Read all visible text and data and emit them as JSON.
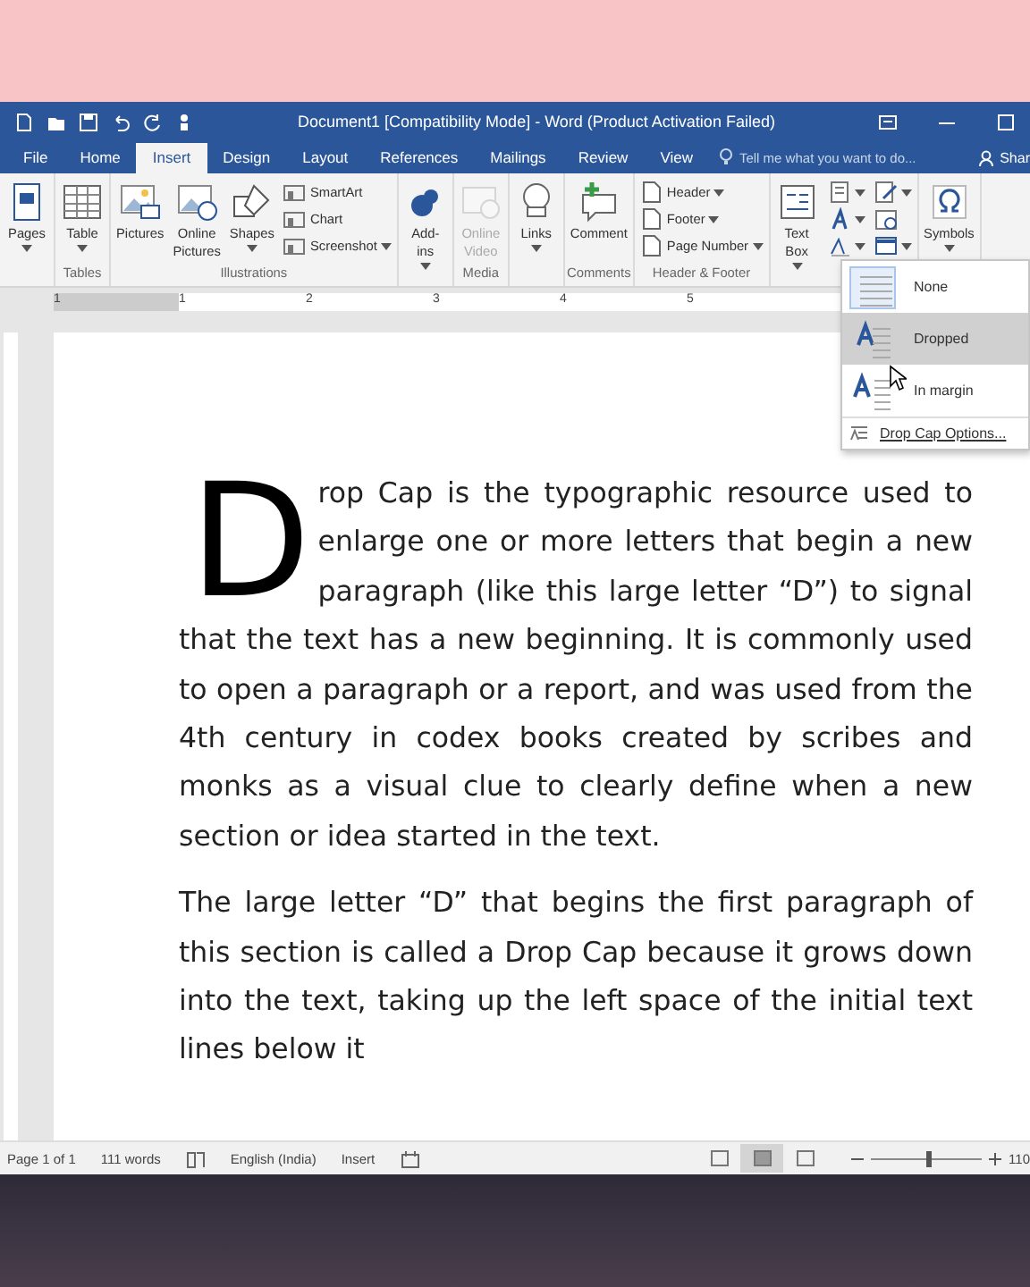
{
  "window": {
    "title": "Document1 [Compatibility Mode] - Word (Product Activation Failed)"
  },
  "tabs": [
    {
      "label": "File",
      "selected": false
    },
    {
      "label": "Home",
      "selected": false
    },
    {
      "label": "Insert",
      "selected": true
    },
    {
      "label": "Design",
      "selected": false
    },
    {
      "label": "Layout",
      "selected": false
    },
    {
      "label": "References",
      "selected": false
    },
    {
      "label": "Mailings",
      "selected": false
    },
    {
      "label": "Review",
      "selected": false
    },
    {
      "label": "View",
      "selected": false
    }
  ],
  "tell_me": {
    "placeholder": "Tell me what you want to do..."
  },
  "share": "Shar",
  "ribbon": {
    "groups": [
      {
        "buttons": [
          {
            "kind": "large",
            "label": "Pages",
            "has_menu": true,
            "disabled": false
          }
        ]
      },
      {
        "label": "Tables",
        "buttons": [
          {
            "kind": "large",
            "label": "Table",
            "has_menu": true,
            "disabled": false
          }
        ]
      },
      {
        "label": "Illustrations",
        "buttons": [
          {
            "kind": "large",
            "label": "Pictures",
            "has_menu": false,
            "disabled": false
          },
          {
            "kind": "large",
            "label": "Online\nPictures",
            "has_menu": false,
            "disabled": false
          },
          {
            "kind": "large",
            "label": "Shapes",
            "has_menu": true,
            "disabled": false
          },
          {
            "kind": "small",
            "label": "SmartArt",
            "has_menu": false,
            "disabled": false
          },
          {
            "kind": "small",
            "label": "Chart",
            "has_menu": false,
            "disabled": false
          },
          {
            "kind": "small",
            "label": "Screenshot",
            "has_menu": true,
            "disabled": false
          }
        ]
      },
      {
        "buttons": [
          {
            "kind": "large",
            "label": "Add-\nins",
            "has_menu": true,
            "disabled": false
          }
        ]
      },
      {
        "label": "Media",
        "buttons": [
          {
            "kind": "large",
            "label": "Online\nVideo",
            "has_menu": false,
            "disabled": true
          }
        ]
      },
      {
        "buttons": [
          {
            "kind": "large",
            "label": "Links",
            "has_menu": true,
            "disabled": false
          }
        ]
      },
      {
        "label": "Comments",
        "buttons": [
          {
            "kind": "large",
            "label": "Comment",
            "has_menu": false,
            "disabled": false
          }
        ]
      },
      {
        "label": "Header & Footer",
        "buttons": [
          {
            "kind": "small",
            "label": "Header",
            "has_menu": true,
            "disabled": false
          },
          {
            "kind": "small",
            "label": "Footer",
            "has_menu": true,
            "disabled": false
          },
          {
            "kind": "small",
            "label": "Page Number",
            "has_menu": true,
            "disabled": false
          }
        ]
      },
      {
        "buttons": [
          {
            "kind": "large",
            "label": "Text\nBox",
            "has_menu": true,
            "disabled": false
          },
          {
            "kind": "icon",
            "has_menu": true,
            "disabled": false
          },
          {
            "kind": "icon",
            "has_menu": true,
            "disabled": false
          },
          {
            "kind": "icon",
            "has_menu": true,
            "disabled": false
          },
          {
            "kind": "icon",
            "has_menu": true,
            "disabled": false
          },
          {
            "kind": "icon",
            "has_menu": false,
            "disabled": false
          },
          {
            "kind": "icon",
            "has_menu": true,
            "disabled": false
          }
        ]
      },
      {
        "buttons": [
          {
            "kind": "large",
            "label": "Symbols",
            "has_menu": true,
            "disabled": false
          }
        ]
      }
    ]
  },
  "ruler": {
    "labels": [
      "1",
      "1",
      "2",
      "3",
      "4",
      "5"
    ]
  },
  "document": {
    "paragraphs": [
      {
        "text": "Drop Cap is the typographic resource used to enlarge one or more letters that begin a new paragraph (like this large letter “D”) to signal that the text has a new beginning. It is commonly used to open a paragraph or a report, and was used from the 4th century in codex books created by scribes and monks as a visual clue to clearly define when a new section or idea started in the text.",
        "drop_cap": true
      },
      {
        "text": "The large letter “D” that begins the first paragraph of this section is called a Drop Cap because it grows down into the text, taking up the left space of the initial text lines below it",
        "drop_cap": false
      }
    ]
  },
  "drop_cap_menu": {
    "items": [
      {
        "label": "None",
        "selected": true,
        "highlighted": false
      },
      {
        "label": "Dropped",
        "selected": false,
        "highlighted": true
      },
      {
        "label": "In margin",
        "selected": false,
        "highlighted": false
      }
    ],
    "options": "Drop Cap Options..."
  },
  "status_bar": {
    "page": "Page 1 of 1",
    "words": "111 words",
    "language": "English (India)",
    "mode": "Insert",
    "views": [
      {
        "selected": false
      },
      {
        "selected": true
      },
      {
        "selected": false
      }
    ],
    "zoom_slider": {
      "level": 0.5
    },
    "zoom": "110"
  }
}
